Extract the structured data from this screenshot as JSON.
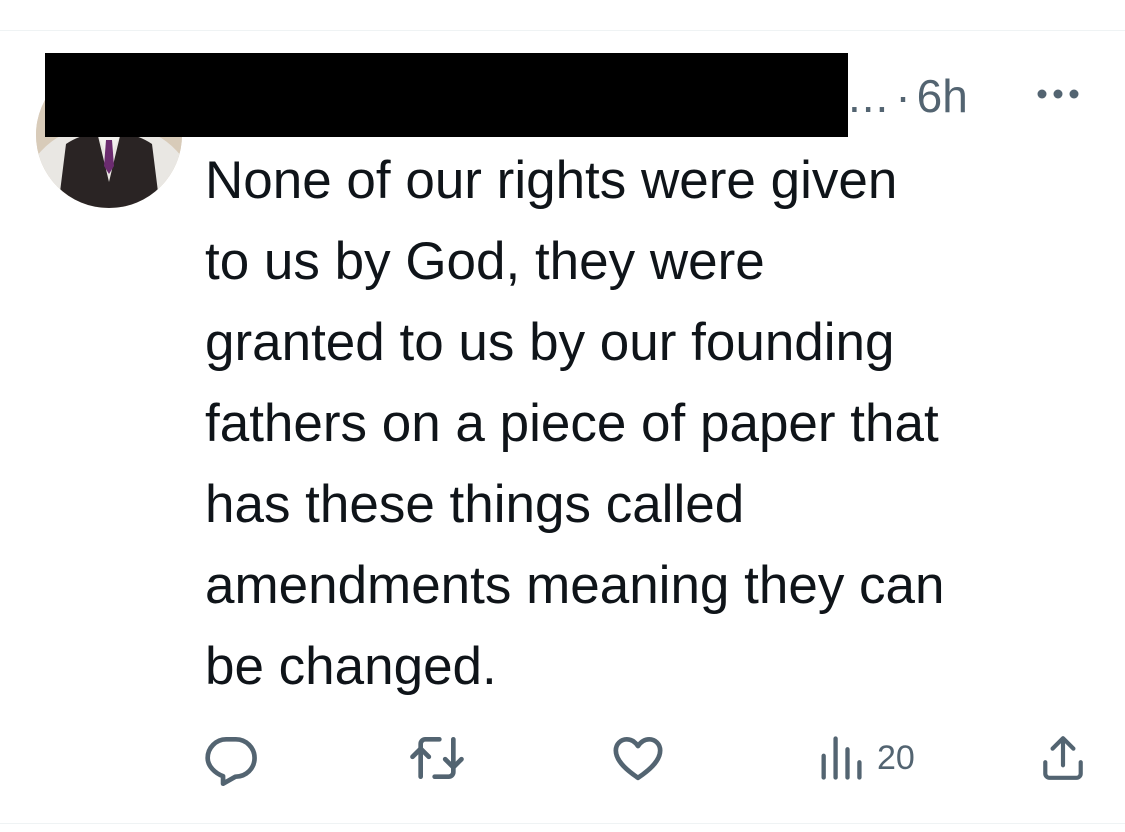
{
  "tweet": {
    "author": {
      "name_redacted": true,
      "avatar": "avatar"
    },
    "truncation": "...",
    "separator": "·",
    "timestamp": "6h",
    "more_icon": "more-horizontal-icon",
    "text": "None of our rights were given\nto us by God, they were\ngranted to us by our founding\nfathers on a piece of paper that\nhas these things called\namendments meaning they can\nbe changed.",
    "actions": {
      "reply_icon": "reply-icon",
      "repost_icon": "repost-icon",
      "like_icon": "like-icon",
      "views_icon": "views-icon",
      "views_count": "20",
      "share_icon": "share-icon"
    }
  },
  "colors": {
    "text_primary": "#0f1419",
    "text_secondary": "#536471",
    "divider": "#eff3f4",
    "redaction": "#000000"
  }
}
